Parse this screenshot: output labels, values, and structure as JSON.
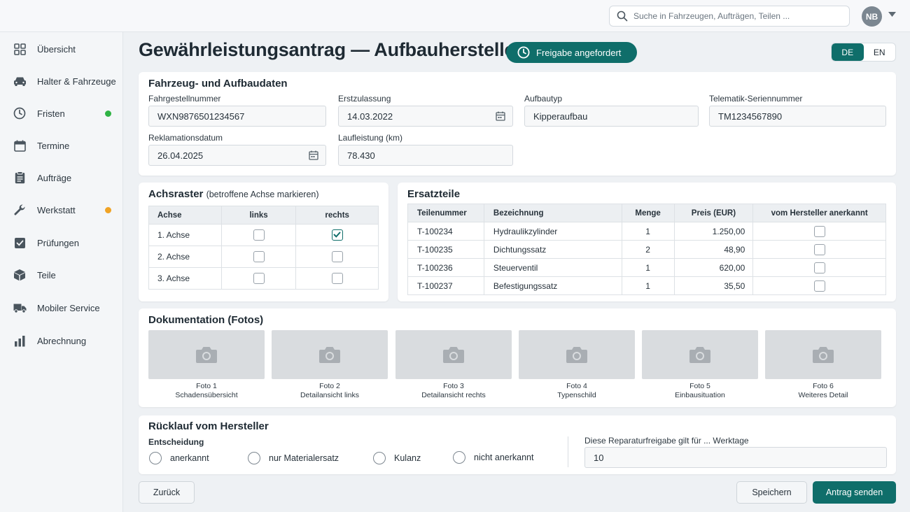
{
  "search": {
    "placeholder": "Suche in Fahrzeugen, Aufträgen, Teilen ..."
  },
  "user": {
    "initials": "NB"
  },
  "sidebar": {
    "items": [
      {
        "label": "Übersicht",
        "icon": "grid-icon"
      },
      {
        "label": "Halter & Fahrzeuge",
        "icon": "car-icon"
      },
      {
        "label": "Fristen",
        "icon": "clock-icon",
        "dot": "#2fb344"
      },
      {
        "label": "Termine",
        "icon": "calendar-icon"
      },
      {
        "label": "Aufträge",
        "icon": "clipboard-icon"
      },
      {
        "label": "Werkstatt",
        "icon": "wrench-icon",
        "dot": "#f0a325"
      },
      {
        "label": "Prüfungen",
        "icon": "checkbox-icon"
      },
      {
        "label": "Teile",
        "icon": "box-icon"
      },
      {
        "label": "Mobiler Service",
        "icon": "truck-icon"
      },
      {
        "label": "Abrechnung",
        "icon": "bar-chart-icon"
      }
    ]
  },
  "header": {
    "title": "Gewährleistungsantrag — Aufbauhersteller",
    "status": "Freigabe angefordert",
    "lang_de": "DE",
    "lang_en": "EN"
  },
  "vehicle": {
    "title": "Fahrzeug- und Aufbaudaten",
    "vin_label": "Fahrgestellnummer",
    "vin": "WXN9876501234567",
    "reg_label": "Erstzulassung",
    "reg": "14.03.2022",
    "body_label": "Aufbautyp",
    "body": "Kipperaufbau",
    "tel_label": "Telematik-Seriennummer",
    "tel": "TM1234567890",
    "claim_label": "Reklamationsdatum",
    "claim": "26.04.2025",
    "km_label": "Laufleistung (km)",
    "km": "78.430"
  },
  "axles": {
    "title": "Achsraster",
    "subtitle": "(betroffene Achse markieren)",
    "headers": [
      "Achse",
      "links",
      "rechts"
    ],
    "rows": [
      {
        "name": "1. Achse",
        "left": false,
        "right": true
      },
      {
        "name": "2. Achse",
        "left": false,
        "right": false
      },
      {
        "name": "3. Achse",
        "left": false,
        "right": false
      }
    ]
  },
  "parts": {
    "title": "Ersatzteile",
    "headers": [
      "Teilenummer",
      "Bezeichnung",
      "Menge",
      "Preis (EUR)",
      "vom Hersteller anerkannt"
    ],
    "rows": [
      {
        "no": "T-100234",
        "desc": "Hydraulikzylinder",
        "qty": "1",
        "price": "1.250,00",
        "ack": false
      },
      {
        "no": "T-100235",
        "desc": "Dichtungssatz",
        "qty": "2",
        "price": "48,90",
        "ack": false
      },
      {
        "no": "T-100236",
        "desc": "Steuerventil",
        "qty": "1",
        "price": "620,00",
        "ack": false
      },
      {
        "no": "T-100237",
        "desc": "Befestigungssatz",
        "qty": "1",
        "price": "35,50",
        "ack": false
      }
    ]
  },
  "docs": {
    "title": "Dokumentation (Fotos)",
    "photos": [
      {
        "label": "Foto 1",
        "caption": "Schadensübersicht"
      },
      {
        "label": "Foto 2",
        "caption": "Detailansicht links"
      },
      {
        "label": "Foto 3",
        "caption": "Detailansicht rechts"
      },
      {
        "label": "Foto 4",
        "caption": "Typenschild"
      },
      {
        "label": "Foto 5",
        "caption": "Einbausituation"
      },
      {
        "label": "Foto 6",
        "caption": "Weiteres Detail"
      }
    ]
  },
  "feedback": {
    "title": "Rücklauf vom Hersteller",
    "decision_label": "Entscheidung",
    "options": [
      "anerkannt",
      "nur Materialersatz",
      "Kulanz",
      "nicht anerkannt"
    ],
    "days_label": "Diese Reparaturfreigabe gilt für ... Werktage",
    "days": "10"
  },
  "actions": {
    "back": "Zurück",
    "save": "Speichern",
    "send": "Antrag senden"
  },
  "colors": {
    "accent": "#0f6e6a",
    "dot_green": "#2fb344",
    "dot_orange": "#f0a325"
  }
}
